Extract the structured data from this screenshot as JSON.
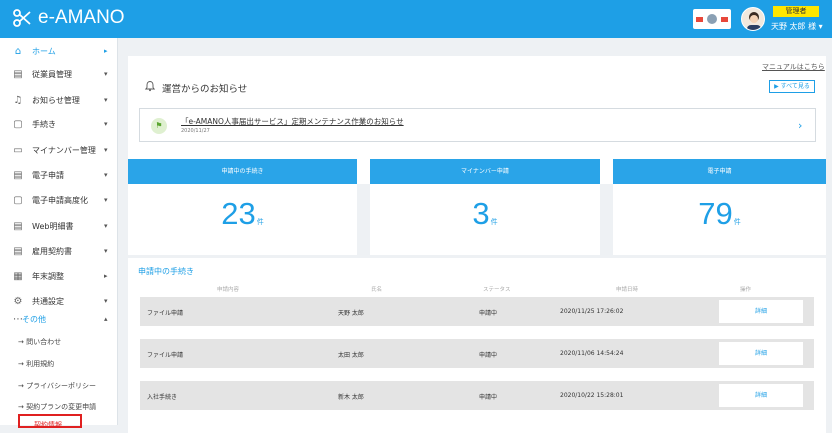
{
  "header": {
    "logo_text": "e-AMANO",
    "role_badge": "管理者",
    "user_name": "天野 太郎 様 ▾",
    "brand_color": "#1e9fe6"
  },
  "sidebar": {
    "items": [
      {
        "label": "ホーム",
        "icon": "home-icon",
        "caret": "▸"
      },
      {
        "label": "従業員管理",
        "icon": "users-icon",
        "caret": "▾"
      },
      {
        "label": "お知らせ管理",
        "icon": "bell-icon",
        "caret": "▾"
      },
      {
        "label": "手続き",
        "icon": "document-icon",
        "caret": "▾"
      },
      {
        "label": "マイナンバー管理",
        "icon": "id-card-icon",
        "caret": "▾"
      },
      {
        "label": "電子申請",
        "icon": "clipboard-icon",
        "caret": "▾"
      },
      {
        "label": "電子申請高度化",
        "icon": "copy-icon",
        "caret": "▾"
      },
      {
        "label": "Web明細書",
        "icon": "payslip-icon",
        "caret": "▾"
      },
      {
        "label": "雇用契約書",
        "icon": "contract-icon",
        "caret": "▾"
      },
      {
        "label": "年末調整",
        "icon": "calculator-icon",
        "caret": "▸"
      },
      {
        "label": "共通設定",
        "icon": "gear-icon",
        "caret": "▾"
      },
      {
        "label": "その他",
        "icon": "ellipsis-icon",
        "caret": "▴"
      }
    ],
    "sub_items": [
      "→ 問い合わせ",
      "→ 利用規約",
      "→ プライバシーポリシー",
      "→ 契約プランの変更申請",
      "契約情報"
    ]
  },
  "notice": {
    "title": "運営からのお知らせ",
    "manual_link": "マニュアルはこちら",
    "all_button": "▶ すべて見る",
    "item_title": "「e-AMANO人事届出サービス」定期メンテナンス作業のお知らせ",
    "item_date": "2020/11/27",
    "arrow": "›"
  },
  "stats": [
    {
      "label": "申請中の手続き",
      "value": "23",
      "unit": "件"
    },
    {
      "label": "マイナンバー申請",
      "value": "3",
      "unit": "件"
    },
    {
      "label": "電子申請",
      "value": "79",
      "unit": "件"
    }
  ],
  "table": {
    "title": "申請中の手続き",
    "columns": [
      "申請内容",
      "氏名",
      "ステータス",
      "申請日時",
      "操作"
    ],
    "rows": [
      {
        "content": "ファイル申請",
        "name": "天野 太郎",
        "status": "申請中",
        "date": "2020/11/25 17:26:02",
        "action": "詳細"
      },
      {
        "content": "ファイル申請",
        "name": "太田 太郎",
        "status": "申請中",
        "date": "2020/11/06 14:54:24",
        "action": "詳細"
      },
      {
        "content": "入社手続き",
        "name": "新木 太郎",
        "status": "申請中",
        "date": "2020/10/22 15:28:01",
        "action": "詳細"
      }
    ]
  }
}
